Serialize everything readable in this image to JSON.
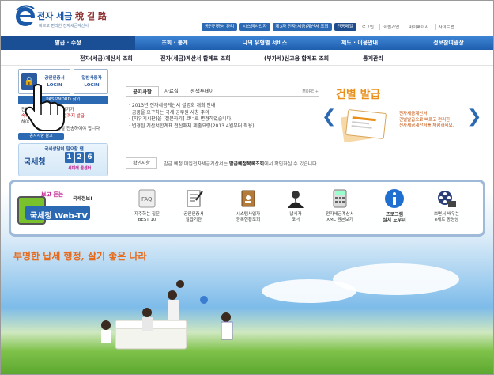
{
  "header": {
    "logo_title": "전자 세금",
    "logo_title_han": "稅 길 路",
    "logo_sub": "빠르고 편리한 전자세금계산서"
  },
  "top_links": [
    "공인인증서 관리",
    "시스템사업자",
    "제3자 전자(세금)계산서 조회",
    "전용메일"
  ],
  "util_links": [
    "로그인",
    "회원가입",
    "마이페이지",
    "사이트맵"
  ],
  "main_nav": [
    "발급 · 수정",
    "조회 · 통계",
    "나의 유형별 서비스",
    "제도 · 이용안내",
    "정보참여광장"
  ],
  "sub_nav": [
    "전자(세금)계산서 조회",
    "전자(세금)계산서 합계표 조회",
    "(부가세)신고용 합계표 조회",
    "통계관리"
  ],
  "login": {
    "cert_line1": "공인인증서",
    "cert_line2": "LOGIN",
    "gen_line1": "일반사용자",
    "gen_line2": "LOGIN",
    "pwd_find": "PASSWORD 찾기",
    "info_1": "전자(세금)계산서 거래시기가",
    "info_2": "속하는 달의 다음달 10일까지 발급",
    "info_3": "해야 하며 ...",
    "info_4": "다음날 전송하여야 합니다",
    "notice_tag": "공지사항 참고"
  },
  "tel": {
    "top": "국세상담이 필요할 땐",
    "name": "국세청",
    "digits": [
      "1",
      "2",
      "6"
    ],
    "sub": "세미래 콜센터"
  },
  "notice": {
    "tabs": [
      "공지사항",
      "자료실",
      "정책투데이"
    ],
    "more": "MORE +",
    "items": [
      "· 2013년 전자세금계산서 설명회 개최 안내",
      "· 금품을 요구하는 국세 공무원 사칭 주의",
      "· [자유게시판]을 [질문하기] 코너로 변경하였습니다.",
      "· 변경된 계산서합계표 전산매체 제출요령(2013.4월부터 적용)"
    ]
  },
  "banner": {
    "title_plain": "건별 ",
    "title_strong": "발급",
    "text_1": "전자세금계산서",
    "text_2": "건별발급으로 빠르고 편리한",
    "text_3": "전자세금계산서를 체험하세요."
  },
  "confirm": {
    "tab": "확인사항",
    "text_pre": "발급 예정 매입전자세금계산서는",
    "text_bold": "발급예정목록조회",
    "text_post": "에서 확인하실 수 있습니다."
  },
  "webtv": {
    "top1": "보고 듣는",
    "top2": "국세정보!",
    "label": "국세청 Web-TV"
  },
  "quick": [
    {
      "line1": "자주하는 질문",
      "line2": "BEST 10",
      "bold": false
    },
    {
      "line1": "공인인증서",
      "line2": "발급기관",
      "bold": false
    },
    {
      "line1": "시스템사업자",
      "line2": "등록현황조회",
      "bold": false
    },
    {
      "line1": "납세자",
      "line2": "코너",
      "bold": false
    },
    {
      "line1": "전자세금계산서",
      "line2": "XML 원본보기",
      "bold": false
    },
    {
      "line1": "프로그램",
      "line2": "설치 도우미",
      "bold": true
    },
    {
      "line1": "보면서 배우는",
      "line2": "e세로 동영상",
      "bold": false
    }
  ],
  "slogan": "투명한 납세 행정, 살기 좋은 나라",
  "colors": {
    "brand": "#2c69b3",
    "nav": "#1f5fae",
    "accent": "#e8901a",
    "slogan": "#e86a1a"
  }
}
